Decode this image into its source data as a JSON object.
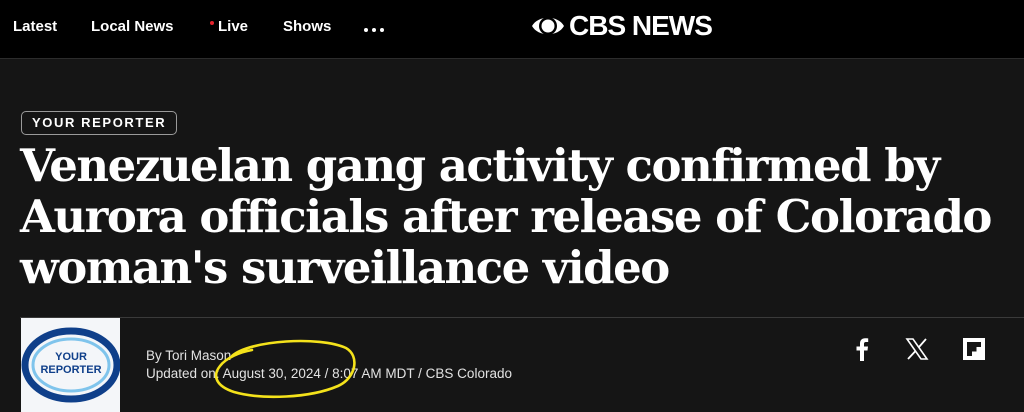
{
  "nav": {
    "items": [
      {
        "label": "Latest"
      },
      {
        "label": "Local News"
      },
      {
        "label": "Live"
      },
      {
        "label": "Shows"
      }
    ],
    "logo": "CBS NEWS",
    "live_dot_color": "#e5232c"
  },
  "article": {
    "tag": "YOUR REPORTER",
    "headline": "Venezuelan gang activity confirmed by Aurora officials after release of Colorado woman's surveillance video",
    "byline": {
      "author_text": "By Tori Mason",
      "updated_text": "Updated on: August 30, 2024 / 8:07 AM MDT / CBS Colorado",
      "avatar_text": [
        "YOUR",
        "REPORTER"
      ]
    }
  },
  "share": {
    "icons": [
      "facebook-icon",
      "x-icon",
      "flipboard-icon"
    ]
  },
  "annotation": {
    "color": "#f4e21b"
  }
}
